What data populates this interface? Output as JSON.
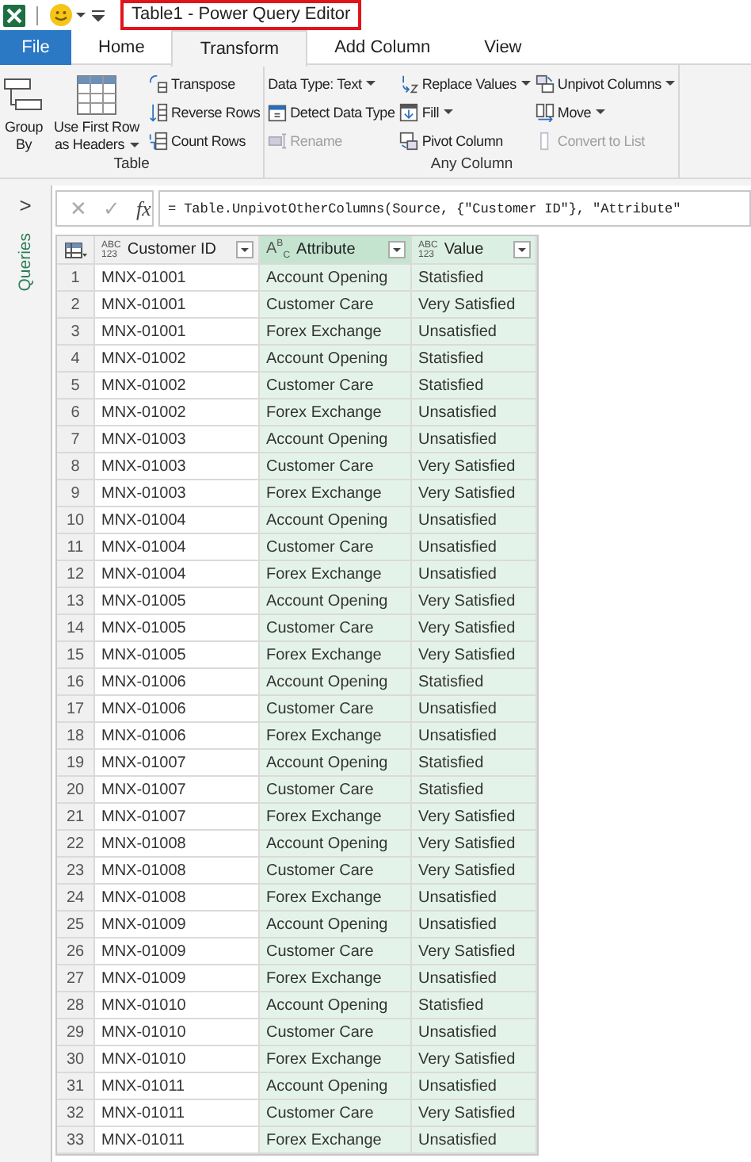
{
  "window": {
    "title": "Table1 - Power Query Editor"
  },
  "tabs": [
    {
      "label": "File",
      "kind": "file",
      "selected": false
    },
    {
      "label": "Home",
      "kind": "tab",
      "selected": false
    },
    {
      "label": "Transform",
      "kind": "tab",
      "selected": true
    },
    {
      "label": "Add Column",
      "kind": "tab",
      "selected": false
    },
    {
      "label": "View",
      "kind": "tab",
      "selected": false
    }
  ],
  "ribbon": {
    "groups": [
      {
        "label": "Table",
        "columns": [
          [
            {
              "label": "Group By",
              "kind": "large",
              "dropdown": false,
              "disabled": false
            }
          ],
          [
            {
              "label": "Use First Row as Headers",
              "kind": "large",
              "dropdown": true,
              "disabled": false
            }
          ],
          [
            {
              "label": "Transpose",
              "kind": "small",
              "dropdown": false,
              "disabled": false
            },
            {
              "label": "Reverse Rows",
              "kind": "small",
              "dropdown": false,
              "disabled": false
            },
            {
              "label": "Count Rows",
              "kind": "small",
              "dropdown": false,
              "disabled": false
            }
          ]
        ]
      },
      {
        "label": "Any Column",
        "columns": [
          [
            {
              "label": "Data Type: Text",
              "kind": "plain",
              "dropdown": true,
              "disabled": false
            },
            {
              "label": "Detect Data Type",
              "kind": "small",
              "dropdown": false,
              "disabled": false
            },
            {
              "label": "Rename",
              "kind": "small",
              "dropdown": false,
              "disabled": true
            }
          ],
          [
            {
              "label": "Replace Values",
              "kind": "small",
              "dropdown": true,
              "disabled": false
            },
            {
              "label": "Fill",
              "kind": "small",
              "dropdown": true,
              "disabled": false
            },
            {
              "label": "Pivot Column",
              "kind": "small",
              "dropdown": false,
              "disabled": false
            }
          ],
          [
            {
              "label": "Unpivot Columns",
              "kind": "small",
              "dropdown": true,
              "disabled": false
            },
            {
              "label": "Move",
              "kind": "small",
              "dropdown": true,
              "disabled": false
            },
            {
              "label": "Convert to List",
              "kind": "small",
              "dropdown": false,
              "disabled": true
            }
          ]
        ]
      }
    ]
  },
  "queries_pane": {
    "toggle": ">",
    "label": "Queries"
  },
  "formula_bar": {
    "cancel": "✕",
    "confirm": "✓",
    "fx": "fx",
    "formula": "= Table.UnpivotOtherColumns(Source, {\"Customer ID\"}, \"Attribute\""
  },
  "table": {
    "columns": [
      {
        "name": "Customer ID",
        "type": {
          "kind": "any",
          "lines": [
            "ABC",
            "123"
          ]
        },
        "selected": false,
        "active": false
      },
      {
        "name": "Attribute",
        "type": {
          "kind": "text",
          "text": "A$^{B}$$_{C}$"
        },
        "selected": true,
        "active": true
      },
      {
        "name": "Value",
        "type": {
          "kind": "any",
          "lines": [
            "ABC",
            "123"
          ]
        },
        "selected": true,
        "active": false
      }
    ],
    "rows": [
      {
        "index": "1",
        "cells": [
          "MNX-01001",
          "Account Opening",
          "Statisfied"
        ]
      },
      {
        "index": "2",
        "cells": [
          "MNX-01001",
          "Customer Care",
          "Very Satisfied"
        ]
      },
      {
        "index": "3",
        "cells": [
          "MNX-01001",
          "Forex Exchange",
          "Unsatisfied"
        ]
      },
      {
        "index": "4",
        "cells": [
          "MNX-01002",
          "Account Opening",
          "Statisfied"
        ]
      },
      {
        "index": "5",
        "cells": [
          "MNX-01002",
          "Customer Care",
          "Statisfied"
        ]
      },
      {
        "index": "6",
        "cells": [
          "MNX-01002",
          "Forex Exchange",
          "Unsatisfied"
        ]
      },
      {
        "index": "7",
        "cells": [
          "MNX-01003",
          "Account Opening",
          "Unsatisfied"
        ]
      },
      {
        "index": "8",
        "cells": [
          "MNX-01003",
          "Customer Care",
          "Very Satisfied"
        ]
      },
      {
        "index": "9",
        "cells": [
          "MNX-01003",
          "Forex Exchange",
          "Very Satisfied"
        ]
      },
      {
        "index": "10",
        "cells": [
          "MNX-01004",
          "Account Opening",
          "Unsatisfied"
        ]
      },
      {
        "index": "11",
        "cells": [
          "MNX-01004",
          "Customer Care",
          "Unsatisfied"
        ]
      },
      {
        "index": "12",
        "cells": [
          "MNX-01004",
          "Forex Exchange",
          "Unsatisfied"
        ]
      },
      {
        "index": "13",
        "cells": [
          "MNX-01005",
          "Account Opening",
          "Very Satisfied"
        ]
      },
      {
        "index": "14",
        "cells": [
          "MNX-01005",
          "Customer Care",
          "Very Satisfied"
        ]
      },
      {
        "index": "15",
        "cells": [
          "MNX-01005",
          "Forex Exchange",
          "Very Satisfied"
        ]
      },
      {
        "index": "16",
        "cells": [
          "MNX-01006",
          "Account Opening",
          "Statisfied"
        ]
      },
      {
        "index": "17",
        "cells": [
          "MNX-01006",
          "Customer Care",
          "Unsatisfied"
        ]
      },
      {
        "index": "18",
        "cells": [
          "MNX-01006",
          "Forex Exchange",
          "Unsatisfied"
        ]
      },
      {
        "index": "19",
        "cells": [
          "MNX-01007",
          "Account Opening",
          "Statisfied"
        ]
      },
      {
        "index": "20",
        "cells": [
          "MNX-01007",
          "Customer Care",
          "Statisfied"
        ]
      },
      {
        "index": "21",
        "cells": [
          "MNX-01007",
          "Forex Exchange",
          "Very Satisfied"
        ]
      },
      {
        "index": "22",
        "cells": [
          "MNX-01008",
          "Account Opening",
          "Very Satisfied"
        ]
      },
      {
        "index": "23",
        "cells": [
          "MNX-01008",
          "Customer Care",
          "Very Satisfied"
        ]
      },
      {
        "index": "24",
        "cells": [
          "MNX-01008",
          "Forex Exchange",
          "Unsatisfied"
        ]
      },
      {
        "index": "25",
        "cells": [
          "MNX-01009",
          "Account Opening",
          "Unsatisfied"
        ]
      },
      {
        "index": "26",
        "cells": [
          "MNX-01009",
          "Customer Care",
          "Very Satisfied"
        ]
      },
      {
        "index": "27",
        "cells": [
          "MNX-01009",
          "Forex Exchange",
          "Unsatisfied"
        ]
      },
      {
        "index": "28",
        "cells": [
          "MNX-01010",
          "Account Opening",
          "Statisfied"
        ]
      },
      {
        "index": "29",
        "cells": [
          "MNX-01010",
          "Customer Care",
          "Unsatisfied"
        ]
      },
      {
        "index": "30",
        "cells": [
          "MNX-01010",
          "Forex Exchange",
          "Very Satisfied"
        ]
      },
      {
        "index": "31",
        "cells": [
          "MNX-01011",
          "Account Opening",
          "Unsatisfied"
        ]
      },
      {
        "index": "32",
        "cells": [
          "MNX-01011",
          "Customer Care",
          "Very Satisfied"
        ]
      },
      {
        "index": "33",
        "cells": [
          "MNX-01011",
          "Forex Exchange",
          "Unsatisfied"
        ]
      }
    ]
  }
}
